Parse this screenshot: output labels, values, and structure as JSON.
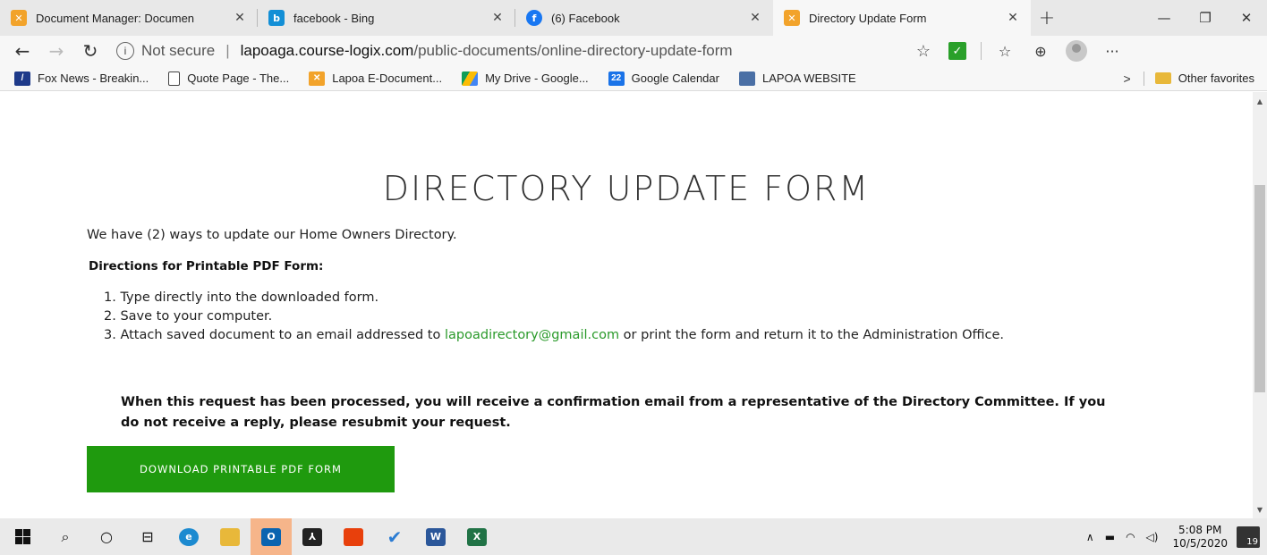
{
  "browser": {
    "tabs": [
      {
        "title": "Document Manager: Documen",
        "icon": "joomla-icon",
        "icon_color": "#f2a32b"
      },
      {
        "title": "facebook - Bing",
        "icon": "bing-icon",
        "icon_color": "#138fd6"
      },
      {
        "title": "(6) Facebook",
        "icon": "facebook-icon",
        "icon_color": "#1877f2"
      },
      {
        "title": "Directory Update Form",
        "icon": "joomla-icon",
        "icon_color": "#f2a32b",
        "active": true
      }
    ],
    "new_tab": "+",
    "address": {
      "security": "Not secure",
      "host": "lapoaga.course-logix.com",
      "path": "/public-documents/online-directory-update-form"
    },
    "favorites": [
      {
        "label": "Fox News - Breakin...",
        "icon": "fox-news-icon",
        "icon_color": "#1e3a8a"
      },
      {
        "label": "Quote Page - The...",
        "icon": "page-icon",
        "icon_color": "#ffffff"
      },
      {
        "label": "Lapoa E-Document...",
        "icon": "joomla-icon",
        "icon_color": "#f2a32b"
      },
      {
        "label": "My Drive - Google...",
        "icon": "google-drive-icon",
        "icon_color": "#fbbc04"
      },
      {
        "label": "Google Calendar",
        "icon": "google-calendar-icon",
        "icon_color": "#1a73e8",
        "icon_text": "22"
      },
      {
        "label": "LAPOA WEBSITE",
        "icon": "lapoa-icon",
        "icon_color": "#4a6fa5"
      }
    ],
    "other_favorites": "Other favorites"
  },
  "page": {
    "title": "DIRECTORY UPDATE FORM",
    "intro": "We have (2) ways to update our Home Owners Directory.",
    "directions_heading": "Directions for Printable PDF Form:",
    "steps": [
      "1. Type directly into the downloaded form.",
      "2. Save to your computer.",
      {
        "before": "3. Attach saved document to an email addressed to ",
        "link": "lapoadirectory@gmail.com",
        "after": " or print the form and return it to the Administration Office."
      }
    ],
    "notice": "When this request has been processed, you will receive a confirmation email from a representative of the Directory Committee. If you do not receive a reply, please resubmit your request.",
    "download_button": "DOWNLOAD PRINTABLE PDF FORM",
    "accent_color": "#1f9a0e",
    "link_color": "#2a9a2a"
  },
  "taskbar": {
    "time": "5:08 PM",
    "date": "10/5/2020",
    "notifications": "19"
  }
}
